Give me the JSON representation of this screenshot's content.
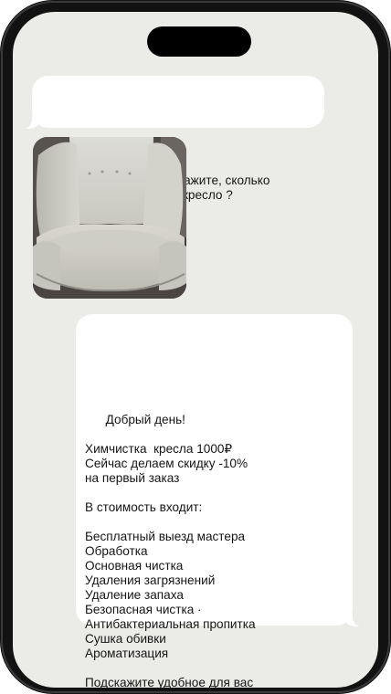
{
  "chat": {
    "incoming_message": "Здравствуйте, подскажите, сколько\nбудет стоить почистить кресло ?",
    "photo_description": "armchair-photo",
    "outgoing_message": "Добрый день!\n\nХимчистка  кресла 1000₽\nСейчас делаем скидку -10%\nна первый заказ\n\nВ стоимость входит:\n\nБесплатный выезд мастера\nОбработка\nОсновная чистка\nУдаления загрязнений\nУдаление запаха\nБезопасная чистка ·\nАнтибактериальная пропитка\nСушка обивки\nАроматизация\n\nПодскажите удобное для вас\nвремя и адрес"
  },
  "colors": {
    "screen_background": "#ebebe8",
    "bubble_background": "#ffffff",
    "text": "#161616",
    "phone_frame": "#121212"
  }
}
